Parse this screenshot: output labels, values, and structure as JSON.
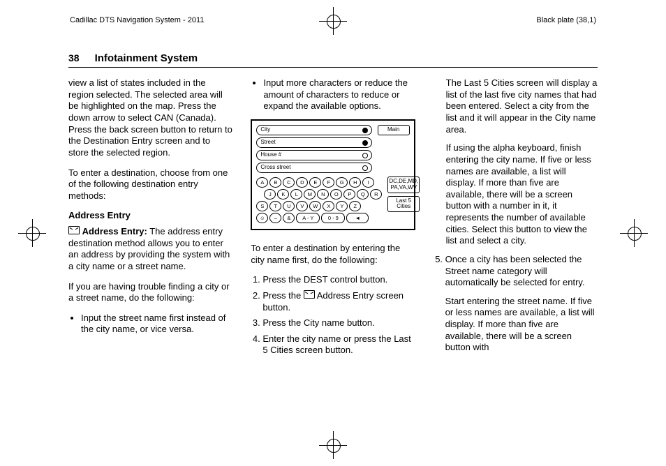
{
  "header": {
    "left": "Cadillac DTS Navigation System - 2011",
    "right": "Black plate (38,1)"
  },
  "pagehead": {
    "number": "38",
    "title": "Infotainment System"
  },
  "col1": {
    "p1": "view a list of states included in the region selected. The selected area will be highlighted on the map. Press the down arrow to select CAN (Canada). Press the back screen button to return to the Destination Entry screen and to store the selected region.",
    "p2": "To enter a destination, choose from one of the following destination entry methods:",
    "sub1": "Address Entry",
    "ae_label": "Address Entry:",
    "ae_text": "   The address entry destination method allows you to enter an address by providing the system with a city name or a street name.",
    "p3": "If you are having trouble finding a city or a street name, do the following:",
    "b1": "Input the street name first instead of the city name, or vice versa."
  },
  "col2": {
    "b1": "Input more characters or reduce the amount of characters to reduce or expand the available options.",
    "fig": {
      "f_city": "City",
      "f_street": "Street",
      "f_house": "House #",
      "f_cross": "Cross street",
      "btn_main": "Main",
      "btn_region": "DC,DE,MD,\nPA,VA,WV",
      "btn_last5": "Last 5\nCities",
      "kb_sp": "&",
      "kb_ay": "A - Y",
      "kb_09": "0 - 9",
      "kb_back": "◄"
    },
    "p1": "To enter a destination by entering the city name first, do the following:",
    "o1": "Press the DEST control button.",
    "o2a": "Press the ",
    "o2b": " Address Entry screen button.",
    "o3": "Press the City name button.",
    "o4": "Enter the city name or press the Last 5 Cities screen button."
  },
  "col3": {
    "s1": "The Last 5 Cities screen will display a list of the last five city names that had been entered. Select a city from the list and it will appear in the City name area.",
    "s2": "If using the alpha keyboard, finish entering the city name. If five or less names are available, a list will display. If more than five are available, there will be a screen button with a number in it, it represents the number of available cities. Select this button to view the list and select a city.",
    "o5": "Once a city has been selected the Street name category will automatically be selected for entry.",
    "o5b": "Start entering the street name. If five or less names are available, a list will display. If more than five are available, there will be a screen button with"
  },
  "kb": {
    "r1": [
      "A",
      "B",
      "C",
      "D",
      "E",
      "F",
      "G",
      "H",
      "I"
    ],
    "r2": [
      "J",
      "K",
      "L",
      "M",
      "N",
      "O",
      "P",
      "Q",
      "R"
    ],
    "r3": [
      "S",
      "T",
      "U",
      "V",
      "W",
      "X",
      "Y",
      "Z"
    ]
  }
}
